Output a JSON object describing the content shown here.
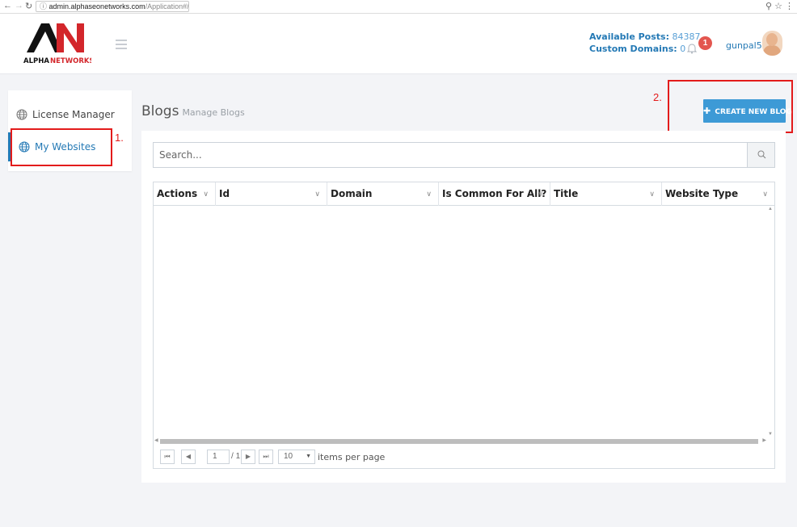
{
  "browser": {
    "url_host": "admin.alphaseonetworks.com",
    "url_path": "/Application#/userBlogs"
  },
  "header": {
    "logo_text_a": "ALPHA",
    "logo_text_b": "NETWORKS",
    "available_posts_label": "Available Posts:",
    "available_posts_value": "84387",
    "custom_domains_label": "Custom Domains:",
    "custom_domains_value": "0",
    "notification_count": "1",
    "username": "gunpal5",
    "brand_color": "#2479b5",
    "badge_color": "#e3564f"
  },
  "sidebar": {
    "items": [
      {
        "label": "License Manager",
        "icon": "globe-icon",
        "active": false
      },
      {
        "label": "My Websites",
        "icon": "globe-icon",
        "active": true
      }
    ]
  },
  "annotations": {
    "label_1": "1.",
    "label_2": "2.",
    "color": "#e31b1b"
  },
  "page": {
    "title": "Blogs",
    "subtitle": "Manage Blogs",
    "create_button_label": "CREATE NEW BLOG",
    "create_button_color": "#3d9ad6"
  },
  "search": {
    "placeholder": "Search..."
  },
  "grid": {
    "columns": [
      {
        "label": "Actions"
      },
      {
        "label": "Id"
      },
      {
        "label": "Domain"
      },
      {
        "label": "Is Common For All?"
      },
      {
        "label": "Title"
      },
      {
        "label": "Website Type"
      }
    ],
    "rows": []
  },
  "pager": {
    "current_page": "1",
    "total_pages": "1",
    "page_size": "10",
    "items_per_page_label": "items per page"
  }
}
